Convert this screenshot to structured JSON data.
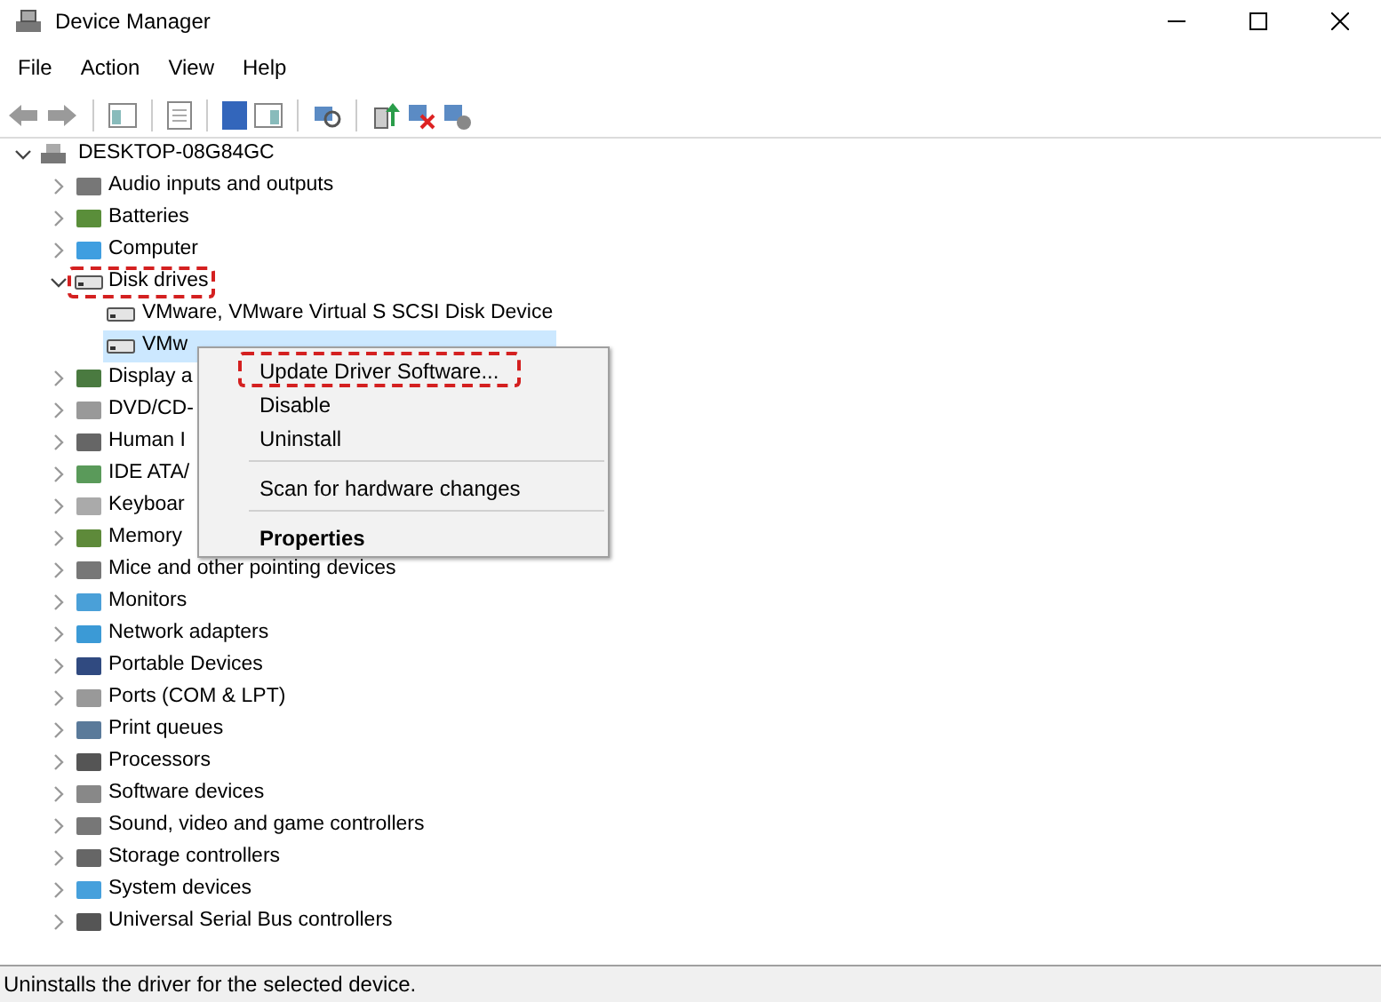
{
  "window": {
    "title": "Device Manager"
  },
  "menu_bar": [
    "File",
    "Action",
    "View",
    "Help"
  ],
  "tree": {
    "label": "DESKTOP-08G84GC",
    "expanded": true,
    "children": [
      {
        "label": "Audio inputs and outputs",
        "expanded": false,
        "highlighted": false
      },
      {
        "label": "Batteries",
        "expanded": false,
        "highlighted": false
      },
      {
        "label": "Computer",
        "expanded": false,
        "highlighted": false
      },
      {
        "label": "Disk drives",
        "expanded": true,
        "highlighted": true,
        "children": [
          {
            "label": "VMware, VMware Virtual S SCSI Disk Device",
            "selected": false
          },
          {
            "label": "VMw",
            "selected": true
          }
        ]
      },
      {
        "label": "Display a",
        "expanded": false,
        "highlighted": false
      },
      {
        "label": "DVD/CD-",
        "expanded": false,
        "highlighted": false
      },
      {
        "label": "Human I",
        "expanded": false,
        "highlighted": false
      },
      {
        "label": "IDE ATA/",
        "expanded": false,
        "highlighted": false
      },
      {
        "label": "Keyboar",
        "expanded": false,
        "highlighted": false
      },
      {
        "label": "Memory",
        "expanded": false,
        "highlighted": false
      },
      {
        "label": "Mice and other pointing devices",
        "expanded": false,
        "highlighted": false
      },
      {
        "label": "Monitors",
        "expanded": false,
        "highlighted": false
      },
      {
        "label": "Network adapters",
        "expanded": false,
        "highlighted": false
      },
      {
        "label": "Portable Devices",
        "expanded": false,
        "highlighted": false
      },
      {
        "label": "Ports (COM & LPT)",
        "expanded": false,
        "highlighted": false
      },
      {
        "label": "Print queues",
        "expanded": false,
        "highlighted": false
      },
      {
        "label": "Processors",
        "expanded": false,
        "highlighted": false
      },
      {
        "label": "Software devices",
        "expanded": false,
        "highlighted": false
      },
      {
        "label": "Sound, video and game controllers",
        "expanded": false,
        "highlighted": false
      },
      {
        "label": "Storage controllers",
        "expanded": false,
        "highlighted": false
      },
      {
        "label": "System devices",
        "expanded": false,
        "highlighted": false
      },
      {
        "label": "Universal Serial Bus controllers",
        "expanded": false,
        "highlighted": false
      }
    ]
  },
  "context_menu": [
    {
      "kind": "item",
      "label": "Update Driver Software...",
      "highlighted": true,
      "default": false
    },
    {
      "kind": "item",
      "label": "Disable",
      "highlighted": false,
      "default": false
    },
    {
      "kind": "item",
      "label": "Uninstall",
      "highlighted": false,
      "default": false
    },
    {
      "kind": "separator"
    },
    {
      "kind": "item",
      "label": "Scan for hardware changes",
      "highlighted": false,
      "default": false
    },
    {
      "kind": "separator"
    },
    {
      "kind": "item",
      "label": "Properties",
      "highlighted": false,
      "default": true
    }
  ],
  "status_bar": "Uninstalls the driver for the selected device."
}
